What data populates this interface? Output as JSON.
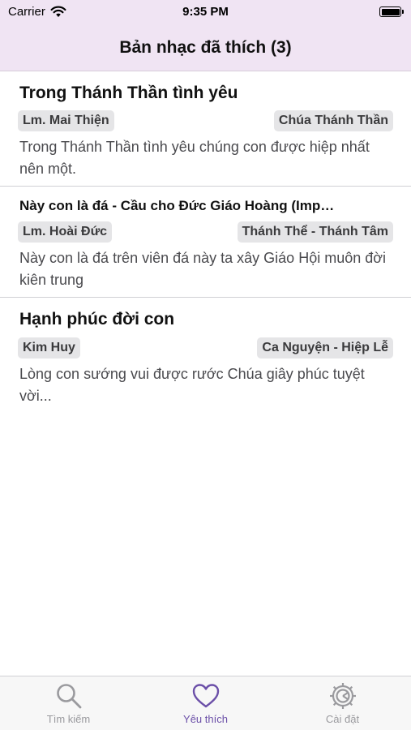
{
  "status_bar": {
    "carrier": "Carrier",
    "time": "9:35 PM"
  },
  "header": {
    "title": "Bản nhạc đã thích (3)"
  },
  "songs": [
    {
      "title": "Trong Thánh Thần tình yêu",
      "author": "Lm. Mai Thiện",
      "category": "Chúa Thánh Thần",
      "excerpt": "Trong Thánh Thần tình yêu chúng con được hiệp nhất nên một."
    },
    {
      "title": "Này con là đá  - Cầu cho Đức Giáo Hoàng (Imp…",
      "author": "Lm. Hoài Đức",
      "category": "Thánh Thể - Thánh Tâm",
      "excerpt": "Này con là đá trên viên đá này ta xây Giáo Hội muôn đời kiên trung"
    },
    {
      "title": "Hạnh phúc đời con",
      "author": "Kim Huy",
      "category": "Ca Nguyện - Hiệp Lễ",
      "excerpt": "Lòng con sướng vui được rước Chúa giây phúc tuyệt vời..."
    }
  ],
  "tab_bar": {
    "tabs": [
      {
        "label": "Tìm kiếm",
        "icon": "search-icon",
        "active": false
      },
      {
        "label": "Yêu thích",
        "icon": "heart-icon",
        "active": true
      },
      {
        "label": "Cài đặt",
        "icon": "gear-icon",
        "active": false
      }
    ]
  },
  "colors": {
    "header_bg": "#f0e4f3",
    "accent": "#6b4fa8",
    "inactive": "#9a9a9e",
    "tag_bg": "#e5e5e7"
  }
}
